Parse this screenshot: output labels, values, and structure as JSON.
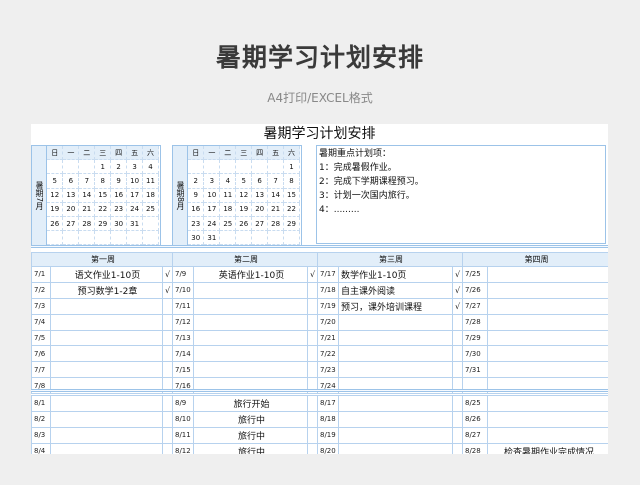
{
  "page": {
    "title": "暑期学习计划安排",
    "subtitle": "A4打印/EXCEL格式"
  },
  "sheet": {
    "title": "暑期学习计划安排",
    "weekdays": [
      "日",
      "一",
      "二",
      "三",
      "四",
      "五",
      "六"
    ],
    "july": {
      "label": "暑期7月",
      "rows": [
        [
          "",
          "",
          "",
          "1",
          "2",
          "3",
          "4"
        ],
        [
          "5",
          "6",
          "7",
          "8",
          "9",
          "10",
          "11"
        ],
        [
          "12",
          "13",
          "14",
          "15",
          "16",
          "17",
          "18"
        ],
        [
          "19",
          "20",
          "21",
          "22",
          "23",
          "24",
          "25"
        ],
        [
          "26",
          "27",
          "28",
          "29",
          "30",
          "31",
          ""
        ],
        [
          "",
          "",
          "",
          "",
          "",
          "",
          ""
        ]
      ]
    },
    "august": {
      "label": "暑期8月",
      "rows": [
        [
          "",
          "",
          "",
          "",
          "",
          "",
          "1"
        ],
        [
          "2",
          "3",
          "4",
          "5",
          "6",
          "7",
          "8"
        ],
        [
          "9",
          "10",
          "11",
          "12",
          "13",
          "14",
          "15"
        ],
        [
          "16",
          "17",
          "18",
          "19",
          "20",
          "21",
          "22"
        ],
        [
          "23",
          "24",
          "25",
          "26",
          "27",
          "28",
          "29"
        ],
        [
          "30",
          "31",
          "",
          "",
          "",
          "",
          ""
        ]
      ]
    },
    "notes": {
      "heading": "暑期重点计划项：",
      "items": [
        "1：完成暑假作业。",
        "2：完成下学期课程预习。",
        "3：计划一次国内旅行。",
        "4：........."
      ]
    },
    "week_headers": [
      "第一周",
      "第二周",
      "第三周",
      "第四周"
    ],
    "july_rows": [
      {
        "d1": "7/1",
        "t1": "语文作业1-10页",
        "c1": "√",
        "d2": "7/9",
        "t2": "英语作业1-10页",
        "c2": "√",
        "d3": "7/17",
        "t3": "数学作业1-10页",
        "c3": "√",
        "d4": "7/25",
        "t4": ""
      },
      {
        "d1": "7/2",
        "t1": "预习数学1-2章",
        "c1": "√",
        "d2": "7/10",
        "t2": "",
        "c2": "",
        "d3": "7/18",
        "t3": "自主课外阅读",
        "c3": "√",
        "d4": "7/26",
        "t4": ""
      },
      {
        "d1": "7/3",
        "t1": "",
        "c1": "",
        "d2": "7/11",
        "t2": "",
        "c2": "",
        "d3": "7/19",
        "t3": "预习，课外培训课程",
        "c3": "√",
        "d4": "7/27",
        "t4": ""
      },
      {
        "d1": "7/4",
        "t1": "",
        "c1": "",
        "d2": "7/12",
        "t2": "",
        "c2": "",
        "d3": "7/20",
        "t3": "",
        "c3": "",
        "d4": "7/28",
        "t4": ""
      },
      {
        "d1": "7/5",
        "t1": "",
        "c1": "",
        "d2": "7/13",
        "t2": "",
        "c2": "",
        "d3": "7/21",
        "t3": "",
        "c3": "",
        "d4": "7/29",
        "t4": ""
      },
      {
        "d1": "7/6",
        "t1": "",
        "c1": "",
        "d2": "7/14",
        "t2": "",
        "c2": "",
        "d3": "7/22",
        "t3": "",
        "c3": "",
        "d4": "7/30",
        "t4": ""
      },
      {
        "d1": "7/7",
        "t1": "",
        "c1": "",
        "d2": "7/15",
        "t2": "",
        "c2": "",
        "d3": "7/23",
        "t3": "",
        "c3": "",
        "d4": "7/31",
        "t4": ""
      },
      {
        "d1": "7/8",
        "t1": "",
        "c1": "",
        "d2": "7/16",
        "t2": "",
        "c2": "",
        "d3": "7/24",
        "t3": "",
        "c3": "",
        "d4": "",
        "t4": ""
      }
    ],
    "august_rows": [
      {
        "d1": "8/1",
        "t1": "",
        "c1": "",
        "d2": "8/9",
        "t2": "旅行开始",
        "c2": "",
        "d3": "8/17",
        "t3": "",
        "c3": "",
        "d4": "8/25",
        "t4": ""
      },
      {
        "d1": "8/2",
        "t1": "",
        "c1": "",
        "d2": "8/10",
        "t2": "旅行中",
        "c2": "",
        "d3": "8/18",
        "t3": "",
        "c3": "",
        "d4": "8/26",
        "t4": ""
      },
      {
        "d1": "8/3",
        "t1": "",
        "c1": "",
        "d2": "8/11",
        "t2": "旅行中",
        "c2": "",
        "d3": "8/19",
        "t3": "",
        "c3": "",
        "d4": "8/27",
        "t4": ""
      },
      {
        "d1": "8/4",
        "t1": "",
        "c1": "",
        "d2": "8/12",
        "t2": "旅行中",
        "c2": "",
        "d3": "8/20",
        "t3": "",
        "c3": "",
        "d4": "8/28",
        "t4": "检查暑期作业完成情况"
      }
    ]
  }
}
